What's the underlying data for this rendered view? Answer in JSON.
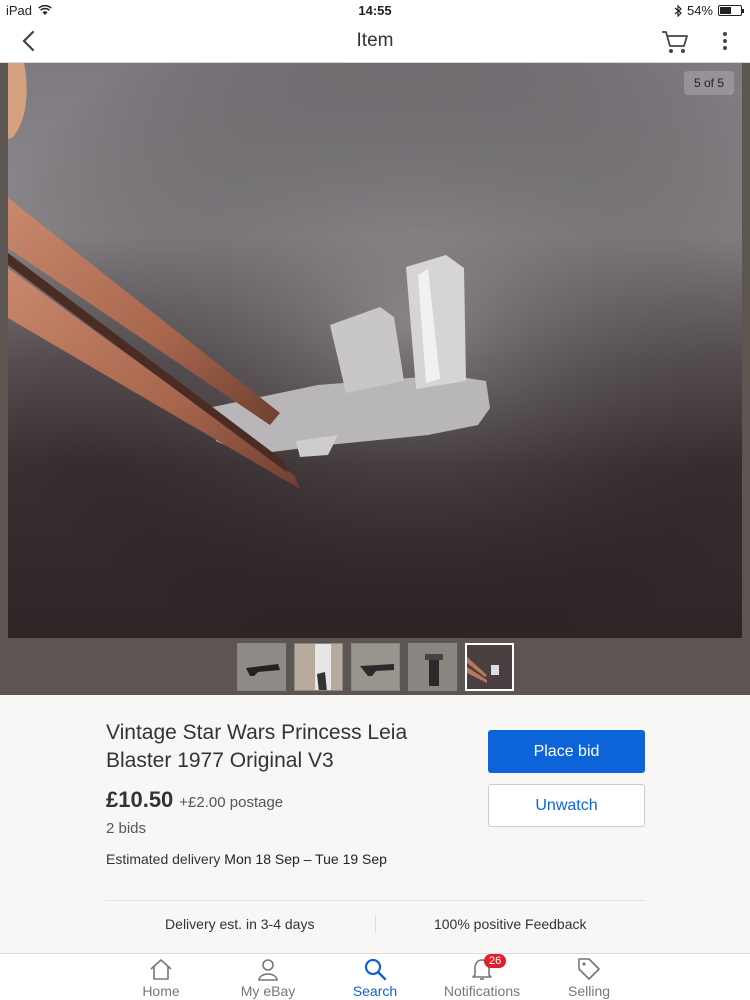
{
  "status_bar": {
    "device": "iPad",
    "time": "14:55",
    "battery": "54%",
    "battery_level": 0.54
  },
  "nav": {
    "title": "Item"
  },
  "gallery": {
    "counter": "5 of 5",
    "selected_index": 4,
    "thumb_count": 5
  },
  "item": {
    "title": "Vintage Star Wars Princess Leia Blaster 1977 Original V3",
    "price": "£10.50",
    "postage": "+£2.00 postage",
    "bids": "2 bids",
    "delivery_label": "Estimated delivery",
    "delivery_dates": "Mon 18 Sep – Tue 19 Sep"
  },
  "actions": {
    "place_bid": "Place bid",
    "unwatch": "Unwatch"
  },
  "info_strip": {
    "delivery": "Delivery est. in 3-4 days",
    "feedback": "100% positive Feedback"
  },
  "tabs": [
    {
      "label": "Home",
      "icon": "home-icon"
    },
    {
      "label": "My eBay",
      "icon": "person-icon"
    },
    {
      "label": "Search",
      "icon": "search-icon"
    },
    {
      "label": "Notifications",
      "icon": "bell-icon",
      "badge": "26"
    },
    {
      "label": "Selling",
      "icon": "tag-icon"
    }
  ],
  "colors": {
    "accent": "#0d64d8",
    "badge": "#e0202a"
  }
}
